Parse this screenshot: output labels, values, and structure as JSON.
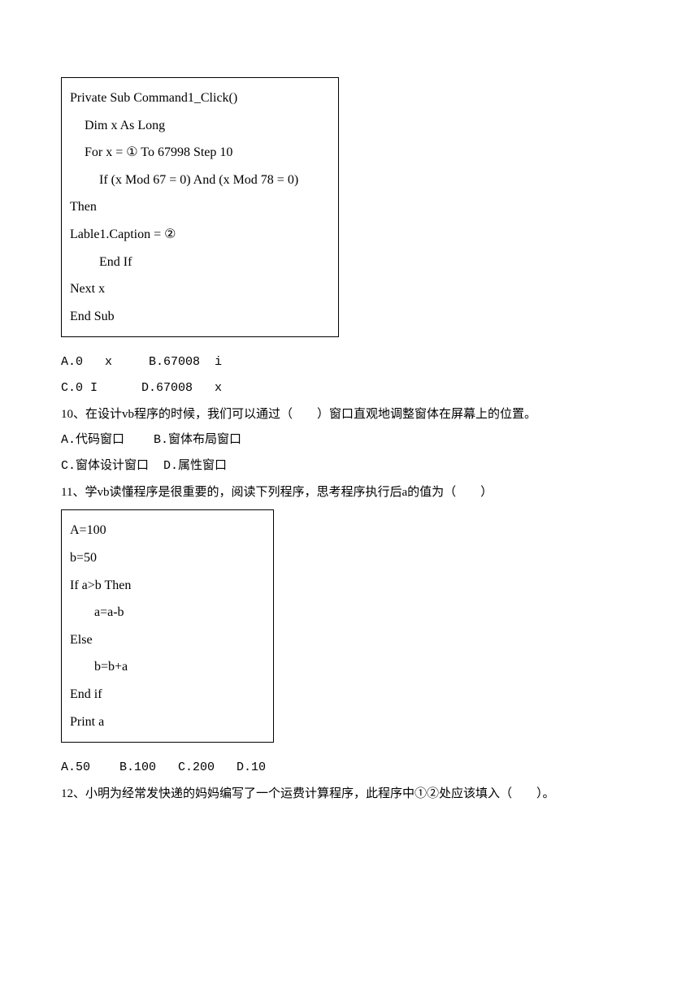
{
  "code1": {
    "l1": "Private Sub Command1_Click()",
    "l2": "Dim x As Long",
    "l3": "For x =  ①  To 67998 Step 10",
    "l4": "If (x Mod 67 = 0) And (x Mod 78 = 0)",
    "l5": "Then",
    "l6": "Lable1.Caption =    ②",
    "l7": "End If",
    "l8": "Next x",
    "l9": "End Sub"
  },
  "q9": {
    "ab": "A.0   x     B.67008  i",
    "cd": "C.0 I      D.67008   x"
  },
  "q10": {
    "text": "10、在设计vb程序的时候，我们可以通过（　　）窗口直观地调整窗体在屏幕上的位置。",
    "ab": "A.代码窗口    B.窗体布局窗口",
    "cd": "C.窗体设计窗口  D.属性窗口"
  },
  "q11": {
    "text": "11、学vb读懂程序是很重要的，阅读下列程序，思考程序执行后a的值为（　　）"
  },
  "code2": {
    "l1": "A=100",
    "l2": "b=50",
    "l3": "If a>b Then",
    "l4": "a=a-b",
    "l5": "Else",
    "l6": "b=b+a",
    "l7": " End if",
    "l8": "Print a"
  },
  "q11b": {
    "abcd": "A.50    B.100   C.200   D.10"
  },
  "q12": {
    "text": "12、小明为经常发快递的妈妈编写了一个运费计算程序，此程序中①②处应该填入（　　）。"
  }
}
